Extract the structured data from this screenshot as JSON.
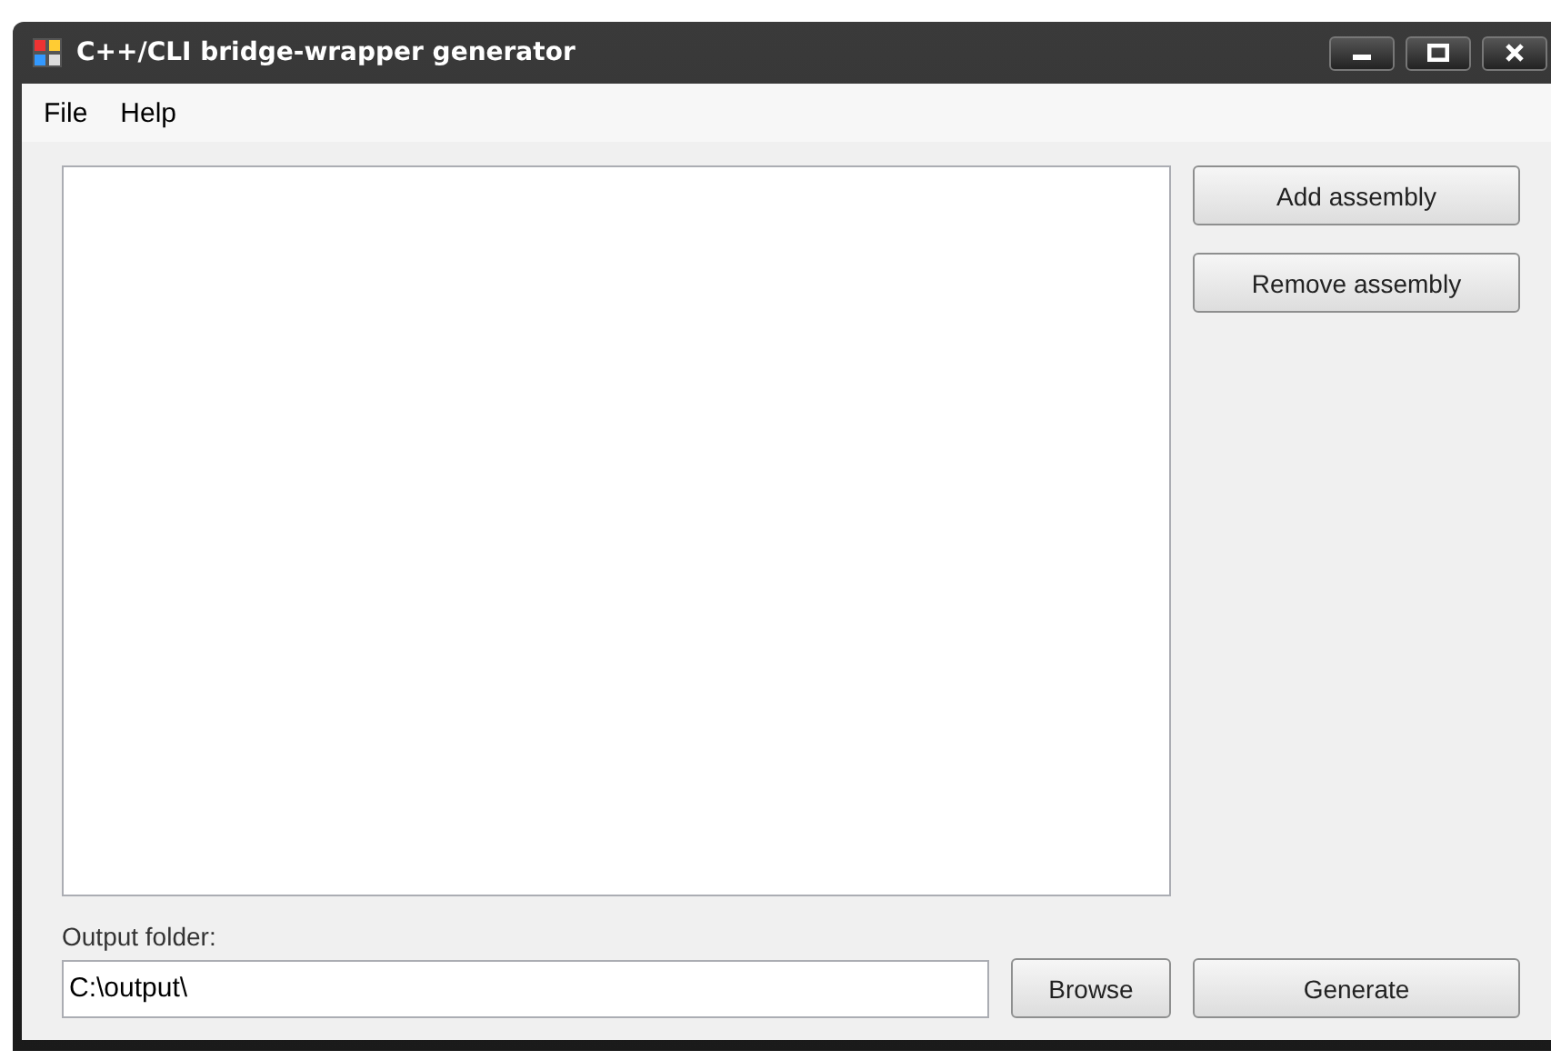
{
  "window": {
    "title": "C++/CLI bridge-wrapper generator"
  },
  "menu": [
    "File",
    "Help"
  ],
  "buttons": [
    "Add assembly",
    "Remove assembly"
  ],
  "output": {
    "label": "Output folder:",
    "value": "C:\\output\\",
    "browse": "Browse",
    "generate": "Generate"
  }
}
